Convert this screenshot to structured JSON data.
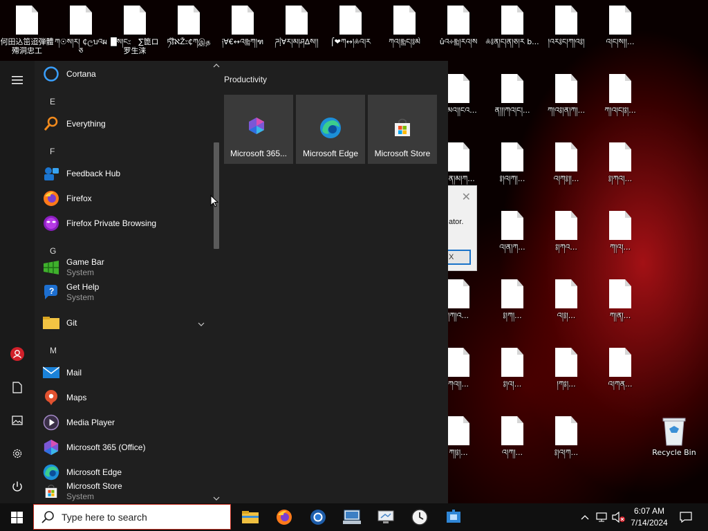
{
  "desktop": {
    "icons": [
      {
        "label": "何田込笜迢弾體殢洞忠工",
        "col": 0,
        "row": 0
      },
      {
        "label": "ཀ☉ས།ར། ₵ලบའผཅ",
        "col": 1,
        "row": 0
      },
      {
        "label": "█ས།ང⹆　∑箆ロ罗生涞",
        "col": 2,
        "row": 0
      },
      {
        "label": "ཏ༔໊ℵŽ⹆₵ཀஇத",
        "col": 3,
        "row": 0
      },
      {
        "label": "༏∀€↔འ༖ཀ།ฑ",
        "col": 4,
        "row": 0
      },
      {
        "label": "ཌ⸽∀ར།མ།ཤ∆ས།།",
        "col": 5,
        "row": 0
      },
      {
        "label": "⌠❤ཀ↔།༜འ།ར",
        "col": 6,
        "row": 0
      },
      {
        "label": "ཀའ།༖ང།༔མེ",
        "col": 7,
        "row": 0
      },
      {
        "label": "ûའ༓༖།རའ།ས",
        "col": 8,
        "row": 0
      },
      {
        "label": "༜༔ན།ང།ན།ཅ།ར b...",
        "col": 9,
        "row": 0
      },
      {
        "label": "།འར༔ང།ཀ།འ༔།",
        "col": 10,
        "row": 0
      },
      {
        "label": "འ།ང།ས།།...",
        "col": 11,
        "row": 0
      },
      {
        "label": "ཀ།མའ།།ངའ...",
        "col": 8,
        "row": 1
      },
      {
        "label": "ན།།།ཀའ།ང།...",
        "col": 9,
        "row": 1
      },
      {
        "label": "ཀ།འ༔།ན།ཀ།...",
        "col": 10,
        "row": 1
      },
      {
        "label": "ཀ།འ།ང།༔།...",
        "col": 11,
        "row": 1
      },
      {
        "label": "འ།ན།མ།ཀ...",
        "col": 8,
        "row": 2
      },
      {
        "label": "༔།འ།ཀ།...",
        "col": 9,
        "row": 2
      },
      {
        "label": "འ།ཀ༔།།...",
        "col": 10,
        "row": 2
      },
      {
        "label": "༔།ཀའ།...",
        "col": 11,
        "row": 2
      },
      {
        "label": "Ä།ཀ༔།འ...",
        "col": 8,
        "row": 3
      },
      {
        "label": "འ།ན།ཀ...",
        "col": 9,
        "row": 3
      },
      {
        "label": "༔།ཀའ...",
        "col": 10,
        "row": 3
      },
      {
        "label": "ཀ།འ།...",
        "col": 11,
        "row": 3
      },
      {
        "label": "།ཀ།འ...",
        "col": 8,
        "row": 4
      },
      {
        "label": "༔།ཀ།...",
        "col": 9,
        "row": 4
      },
      {
        "label": "འ།༔།...",
        "col": 10,
        "row": 4
      },
      {
        "label": "ཀ།ན།...",
        "col": 11,
        "row": 4
      },
      {
        "label": "ཀའ།།...",
        "col": 8,
        "row": 5
      },
      {
        "label": "༔།འ།...",
        "col": 9,
        "row": 5
      },
      {
        "label": "།ཀ༔།...",
        "col": 10,
        "row": 5
      },
      {
        "label": "འ།ཀན...",
        "col": 11,
        "row": 5
      },
      {
        "label": "ཀ།༔།...",
        "col": 8,
        "row": 6
      },
      {
        "label": "འ།ཀ།...",
        "col": 9,
        "row": 6
      },
      {
        "label": "༔།འ།ཀ...",
        "col": 10,
        "row": 6
      }
    ],
    "recycle_bin_label": "Recycle Bin"
  },
  "dialog_fragment": {
    "text": "ator.",
    "button": "X"
  },
  "start_menu": {
    "app_list": [
      {
        "type": "app",
        "name": "Cortana",
        "icon": "cortana-icon"
      },
      {
        "type": "letter",
        "name": "E"
      },
      {
        "type": "app",
        "name": "Everything",
        "icon": "everything-icon"
      },
      {
        "type": "letter",
        "name": "F"
      },
      {
        "type": "app",
        "name": "Feedback Hub",
        "icon": "feedback-hub-icon"
      },
      {
        "type": "app",
        "name": "Firefox",
        "icon": "firefox-icon"
      },
      {
        "type": "app",
        "name": "Firefox Private Browsing",
        "icon": "firefox-private-icon"
      },
      {
        "type": "letter",
        "name": "G"
      },
      {
        "type": "app",
        "name": "Game Bar",
        "sub": "System",
        "icon": "game-bar-icon"
      },
      {
        "type": "app",
        "name": "Get Help",
        "sub": "System",
        "icon": "get-help-icon"
      },
      {
        "type": "folder",
        "name": "Git",
        "icon": "folder-icon"
      },
      {
        "type": "letter",
        "name": "M"
      },
      {
        "type": "app",
        "name": "Mail",
        "icon": "mail-icon"
      },
      {
        "type": "app",
        "name": "Maps",
        "icon": "maps-icon"
      },
      {
        "type": "app",
        "name": "Media Player",
        "icon": "media-player-icon"
      },
      {
        "type": "app",
        "name": "Microsoft 365 (Office)",
        "icon": "office-icon"
      },
      {
        "type": "app",
        "name": "Microsoft Edge",
        "icon": "edge-icon"
      },
      {
        "type": "app",
        "name": "Microsoft Store",
        "sub": "System",
        "icon": "store-icon"
      }
    ],
    "tiles_group": "Productivity",
    "tiles": [
      {
        "label": "Microsoft 365...",
        "icon": "office-icon"
      },
      {
        "label": "Microsoft Edge",
        "icon": "edge-icon"
      },
      {
        "label": "Microsoft Store",
        "icon": "store-icon"
      }
    ]
  },
  "taskbar": {
    "search_placeholder": "Type here to search",
    "time": "6:07 AM",
    "date": "7/14/2024"
  }
}
